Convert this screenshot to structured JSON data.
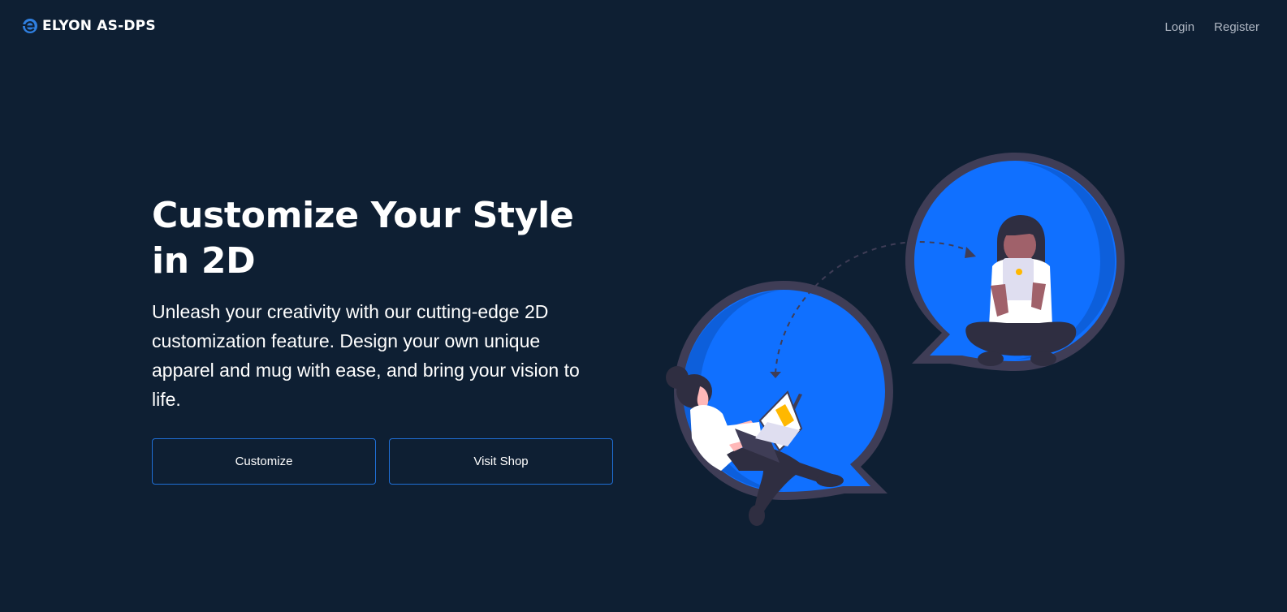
{
  "brand": {
    "name": "ELYON AS-DPS",
    "icon": "e-logo-icon",
    "color": "#2f7fe0"
  },
  "nav": {
    "links": [
      {
        "label": "Login"
      },
      {
        "label": "Register"
      }
    ]
  },
  "hero": {
    "title": "Customize Your Style in 2D",
    "description": "Unleash your creativity with our cutting-edge 2D customization feature. Design your own unique apparel and mug with ease, and bring your vision to life.",
    "buttons": [
      {
        "label": "Customize"
      },
      {
        "label": "Visit Shop"
      }
    ]
  },
  "colors": {
    "background": "#0e1f33",
    "accent": "#1070ff",
    "button_border": "#1f6fd6",
    "bubble_outline": "#3f3d56"
  }
}
